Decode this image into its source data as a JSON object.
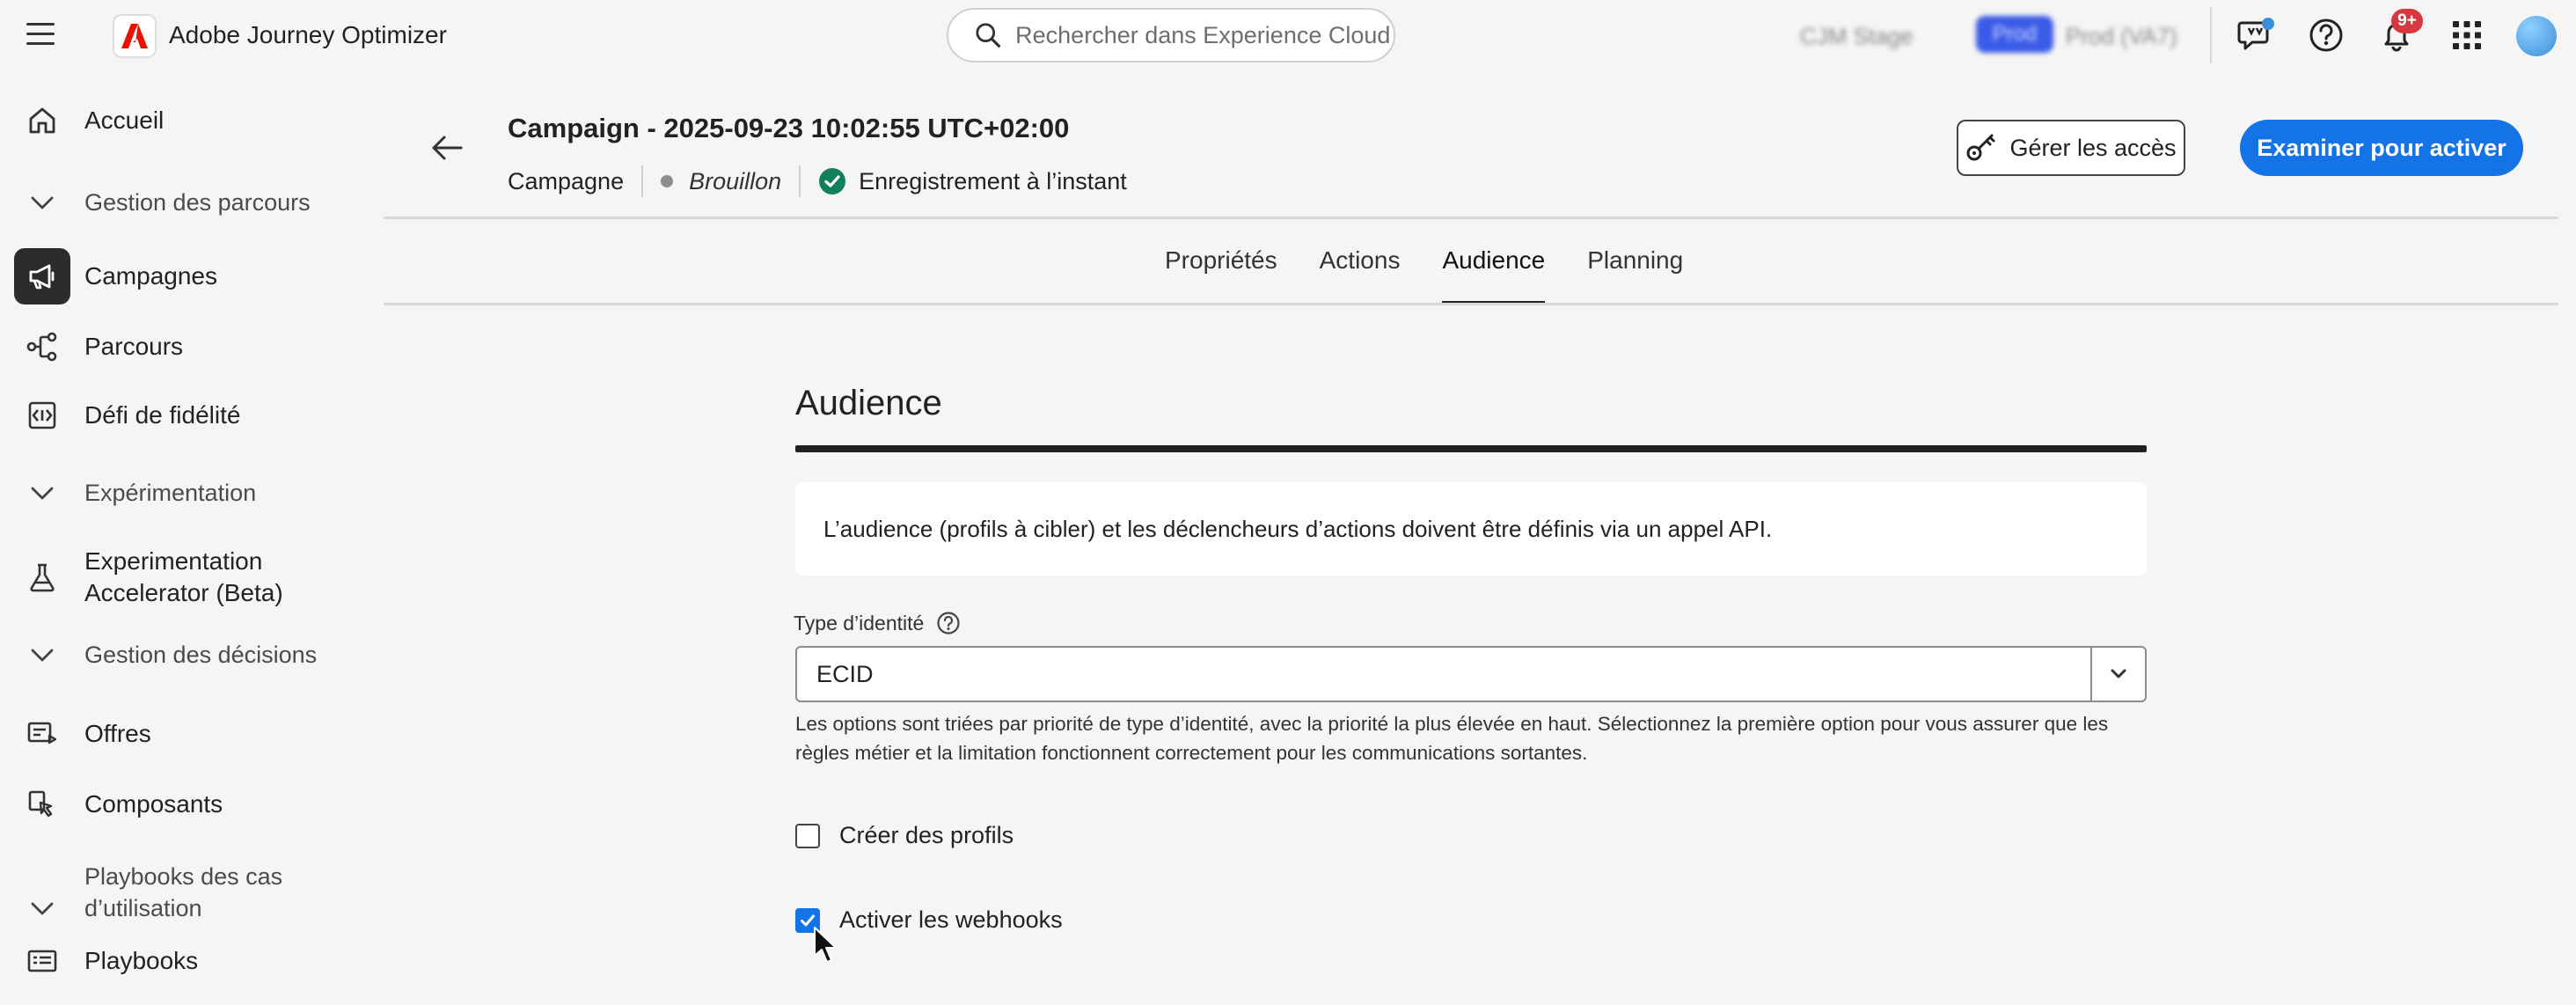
{
  "app": {
    "title": "Adobe Journey Optimizer",
    "search_placeholder": "Rechercher dans Experience Cloud ...",
    "org_sandbox": "CJM Stage",
    "env_pill": "Prod",
    "env_label": "Prod (VA7)",
    "notifications_badge": "9+",
    "accent_color": "#1473e6"
  },
  "sidebar": {
    "home": "Accueil",
    "section_journeys": "Gestion des parcours",
    "campaigns": "Campagnes",
    "journeys": "Parcours",
    "loyalty": "Défi de fidélité",
    "section_experimentation": "Expérimentation",
    "exp_accel_line1": "Experimentation",
    "exp_accel_line2": "Accelerator (Beta)",
    "section_decisions": "Gestion des décisions",
    "offers": "Offres",
    "components": "Composants",
    "section_playbooks_line1": "Playbooks des cas",
    "section_playbooks_line2": "d’utilisation",
    "playbooks": "Playbooks"
  },
  "header": {
    "title": "Campaign - 2025-09-23 10:02:55 UTC+02:00",
    "type": "Campagne",
    "status": "Brouillon",
    "save_status": "Enregistrement à l’instant",
    "manage_access": "Gérer les accès",
    "review_activate": "Examiner pour activer"
  },
  "tabs": [
    {
      "label": "Propriétés"
    },
    {
      "label": "Actions"
    },
    {
      "label": "Audience"
    },
    {
      "label": "Planning"
    }
  ],
  "content": {
    "section_title": "Audience",
    "info": "L’audience (profils à cibler) et les déclencheurs d’actions doivent être définis via un appel API.",
    "identity_label": "Type d’identité",
    "identity_value": "ECID",
    "help": "Les options sont triées par priorité de type d’identité, avec la priorité la plus élevée en haut. Sélectionnez la première option pour vous assurer que les règles métier et la limitation fonctionnent correctement pour les communications sortantes.",
    "create_profiles": "Créer des profils",
    "create_profiles_checked": false,
    "enable_webhooks": "Activer les webhooks",
    "enable_webhooks_checked": true
  }
}
